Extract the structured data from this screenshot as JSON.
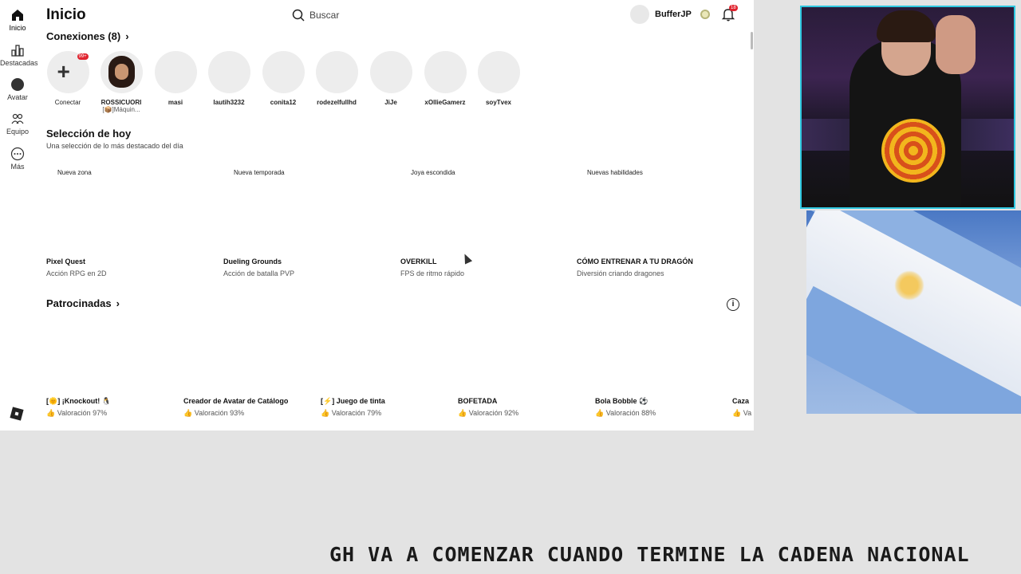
{
  "nav": {
    "items": [
      {
        "label": "Inicio"
      },
      {
        "label": "Destacadas"
      },
      {
        "label": "Avatar"
      },
      {
        "label": "Equipo"
      },
      {
        "label": "Más"
      }
    ]
  },
  "header": {
    "title": "Inicio",
    "search_placeholder": "Buscar",
    "username": "BufferJP",
    "notifications_count": "18"
  },
  "connections": {
    "title": "Conexiones (8)",
    "items": [
      {
        "name": "Conectar",
        "sub": "",
        "badge": "99+"
      },
      {
        "name": "ROSSICUORI",
        "sub": "[📦]Máquin..."
      },
      {
        "name": "masi",
        "sub": ""
      },
      {
        "name": "lautih3232",
        "sub": ""
      },
      {
        "name": "conita12",
        "sub": ""
      },
      {
        "name": "rodezelfullhd",
        "sub": ""
      },
      {
        "name": "JiJe",
        "sub": ""
      },
      {
        "name": "xOllieGamerz",
        "sub": ""
      },
      {
        "name": "soyTvex",
        "sub": ""
      }
    ]
  },
  "today": {
    "title": "Selección de hoy",
    "subtitle": "Una selección de lo más destacado del día",
    "cards": [
      {
        "tag": "Nueva zona",
        "title": "Pixel Quest",
        "sub": "Acción RPG en 2D"
      },
      {
        "tag": "Nueva temporada",
        "title": "Dueling Grounds",
        "sub": "Acción de batalla PVP"
      },
      {
        "tag": "Joya escondida",
        "title": "OVERKILL",
        "sub": "FPS de ritmo rápido"
      },
      {
        "tag": "Nuevas habilidades",
        "title": "CÓMO ENTRENAR A TU DRAGÓN",
        "sub": "Diversión criando dragones"
      }
    ]
  },
  "sponsored": {
    "title": "Patrocinadas",
    "items": [
      {
        "title": "[🌞] ¡Knockout! 🐧",
        "rating": "Valoración 97%"
      },
      {
        "title": "Creador de Avatar de Catálogo",
        "rating": "Valoración 93%"
      },
      {
        "title": "[⚡] Juego de tinta",
        "rating": "Valoración 79%"
      },
      {
        "title": "BOFETADA",
        "rating": "Valoración 92%"
      },
      {
        "title": "Bola Bobble ⚽",
        "rating": "Valoración 88%"
      },
      {
        "title": "Caza",
        "rating": "Va"
      }
    ]
  },
  "overlay": {
    "banner": "GH VA A COMENZAR CUANDO TERMINE LA CADENA NACIONAL"
  }
}
